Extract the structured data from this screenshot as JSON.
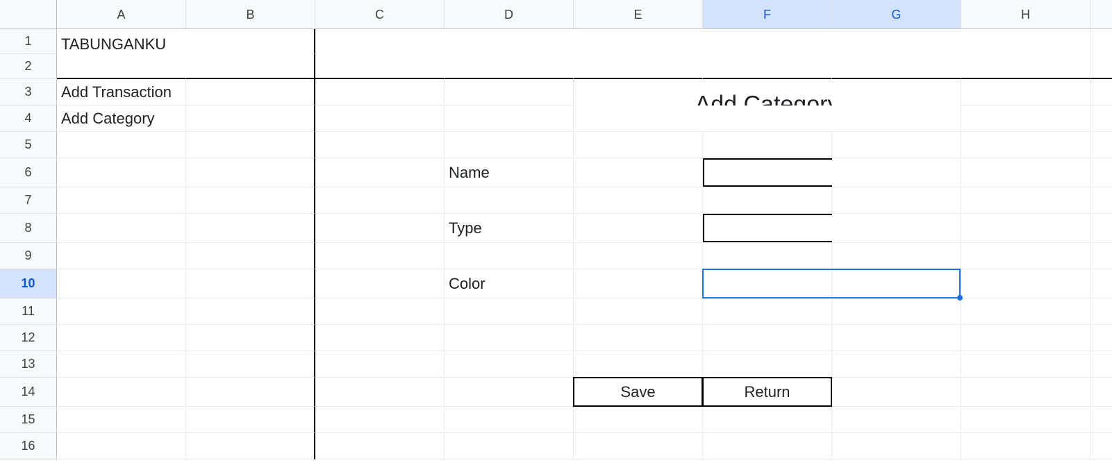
{
  "columns": [
    "A",
    "B",
    "C",
    "D",
    "E",
    "F",
    "G",
    "H"
  ],
  "selected_columns": [
    "F",
    "G"
  ],
  "rows": [
    1,
    2,
    3,
    4,
    5,
    6,
    7,
    8,
    9,
    10,
    11,
    12,
    13,
    14,
    15,
    16
  ],
  "selected_row": 10,
  "sidebar": {
    "title": "TABUNGANKU",
    "items": [
      "Add Transaction",
      "Add Category"
    ]
  },
  "form": {
    "title": "Add Category",
    "fields": {
      "name_label": "Name",
      "type_label": "Type",
      "color_label": "Color"
    },
    "buttons": {
      "save": "Save",
      "return": "Return"
    }
  }
}
